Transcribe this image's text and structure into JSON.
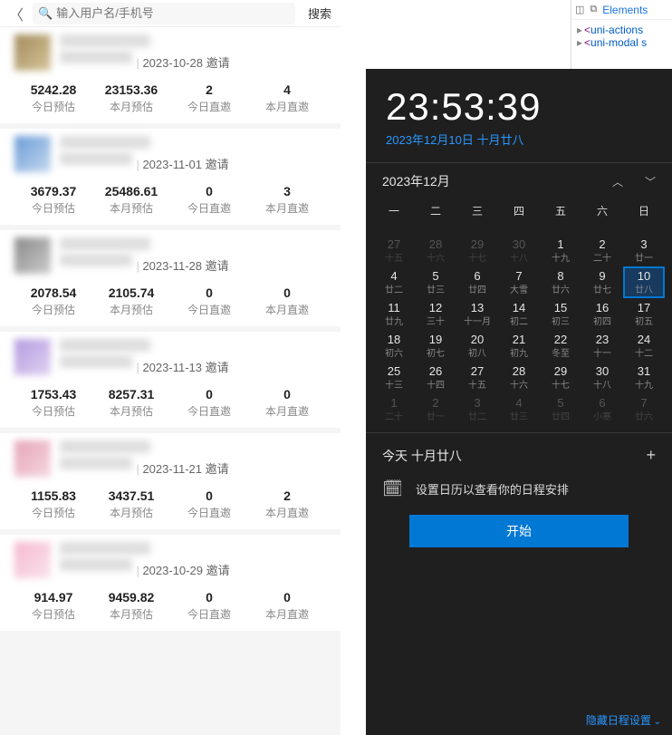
{
  "search": {
    "placeholder": "输入用户名/手机号",
    "button": "搜索"
  },
  "stat_labels": {
    "today_est": "今日预估",
    "month_est": "本月预估",
    "today_inv": "今日直邀",
    "month_inv": "本月直邀"
  },
  "cards": [
    {
      "invite": "2023-10-28 邀请",
      "v1": "5242.28",
      "v2": "23153.36",
      "v3": "2",
      "v4": "4",
      "av": "av1"
    },
    {
      "invite": "2023-11-01 邀请",
      "v1": "3679.37",
      "v2": "25486.61",
      "v3": "0",
      "v4": "3",
      "av": "av2"
    },
    {
      "invite": "2023-11-28 邀请",
      "v1": "2078.54",
      "v2": "2105.74",
      "v3": "0",
      "v4": "0",
      "av": "av3"
    },
    {
      "invite": "2023-11-13 邀请",
      "v1": "1753.43",
      "v2": "8257.31",
      "v3": "0",
      "v4": "0",
      "av": "av4"
    },
    {
      "invite": "2023-11-21 邀请",
      "v1": "1155.83",
      "v2": "3437.51",
      "v3": "0",
      "v4": "2",
      "av": "av5"
    },
    {
      "invite": "2023-10-29 邀请",
      "v1": "914.97",
      "v2": "9459.82",
      "v3": "0",
      "v4": "0",
      "av": "av6"
    }
  ],
  "devtools": {
    "elements_tab": "Elements",
    "line1a": "<",
    "line1b": "uni-actions",
    "line2a": "<",
    "line2b": "uni-modal s"
  },
  "calendar": {
    "time": "23:53:39",
    "date_str": "2023年12月10日 十月廿八",
    "month": "2023年12月",
    "weekdays": [
      "一",
      "二",
      "三",
      "四",
      "五",
      "六",
      "日"
    ],
    "days": [
      {
        "n": "27",
        "s": "十五",
        "dim": true
      },
      {
        "n": "28",
        "s": "十六",
        "dim": true
      },
      {
        "n": "29",
        "s": "十七",
        "dim": true
      },
      {
        "n": "30",
        "s": "十八",
        "dim": true
      },
      {
        "n": "1",
        "s": "十九"
      },
      {
        "n": "2",
        "s": "二十"
      },
      {
        "n": "3",
        "s": "廿一"
      },
      {
        "n": "4",
        "s": "廿二"
      },
      {
        "n": "5",
        "s": "廿三"
      },
      {
        "n": "6",
        "s": "廿四"
      },
      {
        "n": "7",
        "s": "大雪"
      },
      {
        "n": "8",
        "s": "廿六"
      },
      {
        "n": "9",
        "s": "廿七"
      },
      {
        "n": "10",
        "s": "廿八",
        "sel": true
      },
      {
        "n": "11",
        "s": "廿九"
      },
      {
        "n": "12",
        "s": "三十"
      },
      {
        "n": "13",
        "s": "十一月"
      },
      {
        "n": "14",
        "s": "初二"
      },
      {
        "n": "15",
        "s": "初三"
      },
      {
        "n": "16",
        "s": "初四"
      },
      {
        "n": "17",
        "s": "初五"
      },
      {
        "n": "18",
        "s": "初六"
      },
      {
        "n": "19",
        "s": "初七"
      },
      {
        "n": "20",
        "s": "初八"
      },
      {
        "n": "21",
        "s": "初九"
      },
      {
        "n": "22",
        "s": "冬至"
      },
      {
        "n": "23",
        "s": "十一"
      },
      {
        "n": "24",
        "s": "十二"
      },
      {
        "n": "25",
        "s": "十三"
      },
      {
        "n": "26",
        "s": "十四"
      },
      {
        "n": "27",
        "s": "十五"
      },
      {
        "n": "28",
        "s": "十六"
      },
      {
        "n": "29",
        "s": "十七"
      },
      {
        "n": "30",
        "s": "十八"
      },
      {
        "n": "31",
        "s": "十九"
      },
      {
        "n": "1",
        "s": "二十",
        "dim": true
      },
      {
        "n": "2",
        "s": "廿一",
        "dim": true
      },
      {
        "n": "3",
        "s": "廿二",
        "dim": true
      },
      {
        "n": "4",
        "s": "廿三",
        "dim": true
      },
      {
        "n": "5",
        "s": "廿四",
        "dim": true
      },
      {
        "n": "6",
        "s": "小寒",
        "dim": true
      },
      {
        "n": "7",
        "s": "廿六",
        "dim": true
      }
    ],
    "today_label": "今天 十月廿八",
    "setup_text": "设置日历以查看你的日程安排",
    "start": "开始",
    "hide": "隐藏日程设置"
  }
}
